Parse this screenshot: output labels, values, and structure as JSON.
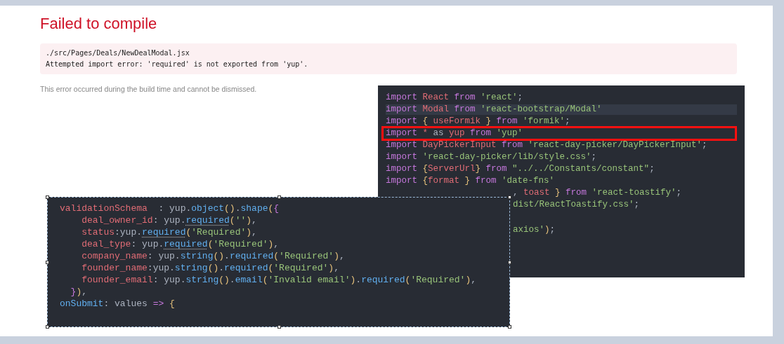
{
  "title": "Failed to compile",
  "error": {
    "file": "./src/Pages/Deals/NewDealModal.jsx",
    "message": "Attempted import error: 'required' is not exported from 'yup'."
  },
  "note": "This error occurred during the build time and cannot be dismissed.",
  "imports_snippet": {
    "lines": [
      {
        "current": false,
        "boxed": false,
        "partial": false,
        "tokens": [
          {
            "kind": "keyword",
            "text": "import "
          },
          {
            "kind": "ident",
            "text": "React "
          },
          {
            "kind": "keyword",
            "text": "from "
          },
          {
            "kind": "string",
            "text": "'react'"
          },
          {
            "kind": "plain",
            "text": ";"
          }
        ]
      },
      {
        "current": true,
        "boxed": false,
        "partial": false,
        "tokens": [
          {
            "kind": "keyword",
            "text": "import "
          },
          {
            "kind": "ident",
            "text": "Modal "
          },
          {
            "kind": "keyword",
            "text": "from "
          },
          {
            "kind": "string",
            "text": "'react-bootstrap/Modal'"
          }
        ]
      },
      {
        "current": false,
        "boxed": false,
        "partial": false,
        "tokens": [
          {
            "kind": "keyword",
            "text": "import "
          },
          {
            "kind": "brace",
            "text": "{ "
          },
          {
            "kind": "ident",
            "text": "useFormik "
          },
          {
            "kind": "brace",
            "text": "} "
          },
          {
            "kind": "keyword",
            "text": "from "
          },
          {
            "kind": "string",
            "text": "'formik'"
          },
          {
            "kind": "plain",
            "text": ";"
          }
        ]
      },
      {
        "current": false,
        "boxed": true,
        "partial": false,
        "tokens": [
          {
            "kind": "keyword",
            "text": "import "
          },
          {
            "kind": "ident",
            "text": "* "
          },
          {
            "kind": "plain",
            "text": "as "
          },
          {
            "kind": "ident",
            "text": "yup "
          },
          {
            "kind": "keyword",
            "text": "from "
          },
          {
            "kind": "string",
            "text": "'yup'"
          }
        ]
      },
      {
        "current": false,
        "boxed": false,
        "partial": false,
        "tokens": [
          {
            "kind": "keyword",
            "text": "import "
          },
          {
            "kind": "ident",
            "text": "DayPickerInput "
          },
          {
            "kind": "keyword",
            "text": "from "
          },
          {
            "kind": "string",
            "text": "'react-day-picker/DayPickerInput'"
          },
          {
            "kind": "plain",
            "text": ";"
          }
        ]
      },
      {
        "current": false,
        "boxed": false,
        "partial": false,
        "tokens": [
          {
            "kind": "keyword",
            "text": "import "
          },
          {
            "kind": "string",
            "text": "'react-day-picker/lib/style.css'"
          },
          {
            "kind": "plain",
            "text": ";"
          }
        ]
      },
      {
        "current": false,
        "boxed": false,
        "partial": false,
        "tokens": [
          {
            "kind": "keyword",
            "text": "import "
          },
          {
            "kind": "brace",
            "text": "{"
          },
          {
            "kind": "ident",
            "text": "ServerUrl"
          },
          {
            "kind": "brace",
            "text": "} "
          },
          {
            "kind": "keyword",
            "text": "from "
          },
          {
            "kind": "string",
            "text": "\"../../Constants/constant\""
          },
          {
            "kind": "plain",
            "text": ";"
          }
        ]
      },
      {
        "current": false,
        "boxed": false,
        "partial": false,
        "tokens": [
          {
            "kind": "keyword",
            "text": "import "
          },
          {
            "kind": "brace",
            "text": "{"
          },
          {
            "kind": "ident",
            "text": "format "
          },
          {
            "kind": "brace",
            "text": "} "
          },
          {
            "kind": "keyword",
            "text": "from "
          },
          {
            "kind": "string",
            "text": "'date-fns'"
          }
        ]
      },
      {
        "current": false,
        "boxed": false,
        "partial": true,
        "tokens": [
          {
            "kind": "plain",
            "text": ", "
          },
          {
            "kind": "ident",
            "text": "toast "
          },
          {
            "kind": "brace",
            "text": "} "
          },
          {
            "kind": "keyword",
            "text": "from "
          },
          {
            "kind": "string",
            "text": "'react-toastify'"
          },
          {
            "kind": "plain",
            "text": ";"
          }
        ]
      },
      {
        "current": false,
        "boxed": false,
        "partial": true,
        "tokens": [
          {
            "kind": "string",
            "text": "dist/ReactToastify.css'"
          },
          {
            "kind": "plain",
            "text": ";"
          }
        ]
      },
      {
        "current": false,
        "boxed": false,
        "partial": true,
        "tokens": [
          {
            "kind": "string",
            "text": "axios'"
          },
          {
            "kind": "brace",
            "text": ")"
          },
          {
            "kind": "plain",
            "text": ";"
          }
        ]
      }
    ]
  },
  "schema_snippet": {
    "lines": [
      {
        "tokens": [
          {
            "kind": "ident",
            "text": "validationSchema  "
          },
          {
            "kind": "plain",
            "text": ": yup."
          },
          {
            "kind": "func",
            "text": "object"
          },
          {
            "kind": "brace",
            "text": "()"
          },
          {
            "kind": "plain",
            "text": "."
          },
          {
            "kind": "func",
            "text": "shape"
          },
          {
            "kind": "brace",
            "text": "("
          },
          {
            "kind": "keyword",
            "text": "{"
          }
        ]
      },
      {
        "tokens": [
          {
            "kind": "ident",
            "text": "    deal_owner_id"
          },
          {
            "kind": "plain",
            "text": ": yup."
          },
          {
            "kind": "warn",
            "text": "required"
          },
          {
            "kind": "brace",
            "text": "("
          },
          {
            "kind": "string",
            "text": "''"
          },
          {
            "kind": "brace",
            "text": ")"
          },
          {
            "kind": "plain",
            "text": ","
          }
        ]
      },
      {
        "tokens": [
          {
            "kind": "ident",
            "text": "    status"
          },
          {
            "kind": "plain",
            "text": ":yup."
          },
          {
            "kind": "warn",
            "text": "required"
          },
          {
            "kind": "brace",
            "text": "("
          },
          {
            "kind": "string",
            "text": "'Required'"
          },
          {
            "kind": "brace",
            "text": ")"
          },
          {
            "kind": "plain",
            "text": ","
          }
        ]
      },
      {
        "tokens": [
          {
            "kind": "ident",
            "text": "    deal_type"
          },
          {
            "kind": "plain",
            "text": ": yup."
          },
          {
            "kind": "warn",
            "text": "required"
          },
          {
            "kind": "brace",
            "text": "("
          },
          {
            "kind": "string",
            "text": "'Required'"
          },
          {
            "kind": "brace",
            "text": ")"
          },
          {
            "kind": "plain",
            "text": ","
          }
        ]
      },
      {
        "tokens": [
          {
            "kind": "ident",
            "text": "    company_name"
          },
          {
            "kind": "plain",
            "text": ": yup."
          },
          {
            "kind": "func",
            "text": "string"
          },
          {
            "kind": "brace",
            "text": "()"
          },
          {
            "kind": "plain",
            "text": "."
          },
          {
            "kind": "func",
            "text": "required"
          },
          {
            "kind": "brace",
            "text": "("
          },
          {
            "kind": "string",
            "text": "'Required'"
          },
          {
            "kind": "brace",
            "text": ")"
          },
          {
            "kind": "plain",
            "text": ","
          }
        ]
      },
      {
        "tokens": [
          {
            "kind": "ident",
            "text": "    founder_name"
          },
          {
            "kind": "plain",
            "text": ":yup."
          },
          {
            "kind": "func",
            "text": "string"
          },
          {
            "kind": "brace",
            "text": "()"
          },
          {
            "kind": "plain",
            "text": "."
          },
          {
            "kind": "func",
            "text": "required"
          },
          {
            "kind": "brace",
            "text": "("
          },
          {
            "kind": "string",
            "text": "'Required'"
          },
          {
            "kind": "brace",
            "text": ")"
          },
          {
            "kind": "plain",
            "text": ","
          }
        ]
      },
      {
        "tokens": [
          {
            "kind": "ident",
            "text": "    founder_email"
          },
          {
            "kind": "plain",
            "text": ": yup."
          },
          {
            "kind": "func",
            "text": "string"
          },
          {
            "kind": "brace",
            "text": "()"
          },
          {
            "kind": "plain",
            "text": "."
          },
          {
            "kind": "func",
            "text": "email"
          },
          {
            "kind": "brace",
            "text": "("
          },
          {
            "kind": "string",
            "text": "'Invalid email'"
          },
          {
            "kind": "brace",
            "text": ")"
          },
          {
            "kind": "plain",
            "text": "."
          },
          {
            "kind": "func",
            "text": "required"
          },
          {
            "kind": "brace",
            "text": "("
          },
          {
            "kind": "string",
            "text": "'Required'"
          },
          {
            "kind": "brace",
            "text": ")"
          },
          {
            "kind": "plain",
            "text": ","
          }
        ]
      },
      {
        "tokens": [
          {
            "kind": "keyword",
            "text": "  }"
          },
          {
            "kind": "brace",
            "text": ")"
          },
          {
            "kind": "plain",
            "text": ","
          }
        ]
      },
      {
        "tokens": [
          {
            "kind": "func",
            "text": "onSubmit"
          },
          {
            "kind": "plain",
            "text": ": values "
          },
          {
            "kind": "keyword",
            "text": "=>"
          },
          {
            "kind": "brace",
            "text": " {"
          }
        ]
      }
    ]
  }
}
